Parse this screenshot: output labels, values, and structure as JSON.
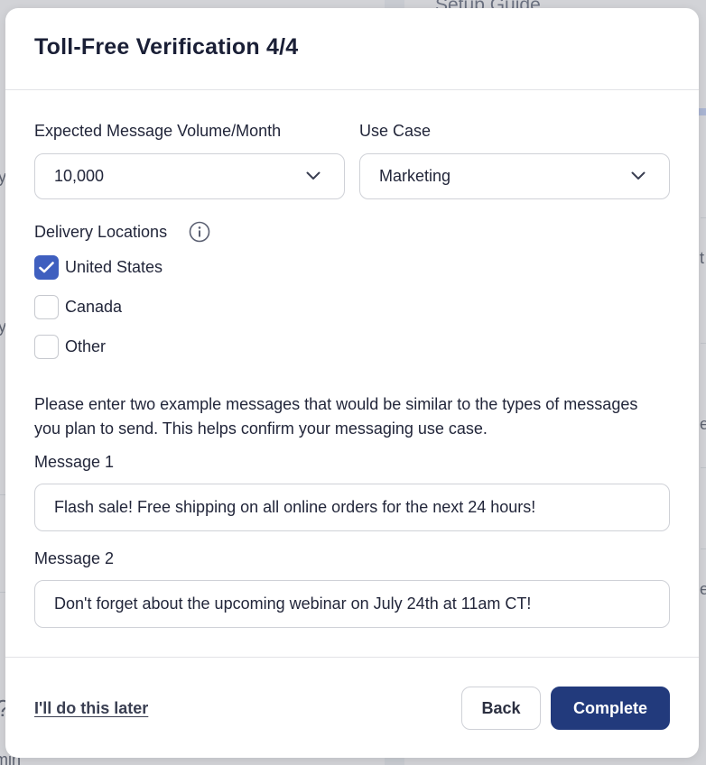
{
  "background": {
    "guide_title": "Setup Guide",
    "fragments": [
      "y",
      "y",
      "t",
      "e",
      "e",
      "?",
      "min"
    ]
  },
  "modal": {
    "title": "Toll-Free Verification 4/4",
    "volume": {
      "label": "Expected Message Volume/Month",
      "value": "10,000"
    },
    "use_case": {
      "label": "Use Case",
      "value": "Marketing"
    },
    "delivery": {
      "label": "Delivery Locations",
      "options": [
        {
          "label": "United States",
          "checked": true
        },
        {
          "label": "Canada",
          "checked": false
        },
        {
          "label": "Other",
          "checked": false
        }
      ]
    },
    "help_text": "Please enter two example messages that would be similar to the types of messages you plan to send. This helps confirm your messaging use case.",
    "message1": {
      "label": "Message 1",
      "value": "Flash sale! Free shipping on all online orders for the next 24 hours!"
    },
    "message2": {
      "label": "Message 2",
      "value": "Don't forget about the upcoming webinar on July 24th at 11am CT!"
    },
    "footer": {
      "later_link": "I'll do this later",
      "back_label": "Back",
      "complete_label": "Complete"
    }
  },
  "colors": {
    "primary": "#223a7c",
    "checkbox_checked": "#3f5fbf",
    "text": "#22263a",
    "border": "#cfd1d7"
  },
  "icons": {
    "chevron": "chevron-down-icon",
    "info": "info-icon",
    "check": "checkmark-icon"
  }
}
